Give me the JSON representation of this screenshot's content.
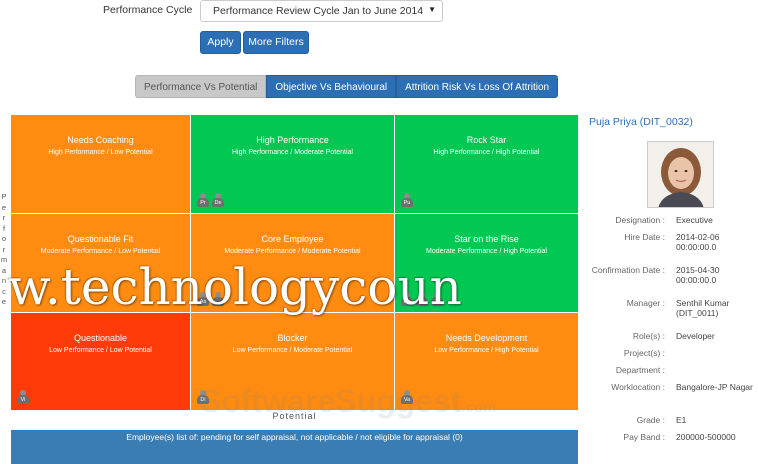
{
  "filters": {
    "performance_cycle_label": "Performance Cycle",
    "performance_cycle_value": "Performance Review Cycle Jan to June 2014",
    "apply_label": "Apply",
    "more_filters_label": "More Filters"
  },
  "tabs": [
    {
      "label": "Performance Vs Potential",
      "active": true
    },
    {
      "label": "Objective Vs Behavioural",
      "active": false
    },
    {
      "label": "Attrition Risk Vs Loss Of Attrition",
      "active": false
    }
  ],
  "grid": {
    "y_axis_label": "Performance",
    "x_axis_label": "Potential",
    "cells": [
      {
        "title": "Needs Coaching",
        "subtitle": "High Performance / Low Potential",
        "color": "#ff8c11",
        "avatars": []
      },
      {
        "title": "High Performance",
        "subtitle": "High Performance / Moderate Potential",
        "color": "#00c853",
        "avatars": [
          "Pr",
          "De"
        ]
      },
      {
        "title": "Rock Star",
        "subtitle": "High Performance / High Potential",
        "color": "#00c853",
        "avatars": [
          "Pu"
        ]
      },
      {
        "title": "Questionable Fit",
        "subtitle": "Moderate Performance / Low Potential",
        "color": "#ff8c11",
        "avatars": []
      },
      {
        "title": "Core Employee",
        "subtitle": "Moderate Performance / Moderate Potential",
        "color": "#ff8c11",
        "avatars": [
          "As",
          ""
        ]
      },
      {
        "title": "Star on the Rise",
        "subtitle": "Moderate Performance / High Potential",
        "color": "#00c853",
        "avatars": [
          "Ra",
          "Ni",
          ""
        ]
      },
      {
        "title": "Questionable",
        "subtitle": "Low Performance / Low Potential",
        "color": "#ff3b0a",
        "avatars": [
          "Vi"
        ]
      },
      {
        "title": "Blocker",
        "subtitle": "Low Performance / Moderate Potential",
        "color": "#ff8c11",
        "avatars": [
          "Di"
        ]
      },
      {
        "title": "Needs Development",
        "subtitle": "Low Performance / High Potential",
        "color": "#ff8c11",
        "avatars": [
          "Va"
        ]
      }
    ]
  },
  "footer": {
    "pending_text": "Employee(s) list of: pending for self appraisal, not applicable / not eligible for appraisal",
    "pending_count": "(0)"
  },
  "profile": {
    "name": "Puja Priya (DIT_0032)",
    "fields": [
      {
        "label": "Designation :",
        "value": "Executive"
      },
      {
        "label": "Hire Date :",
        "value": "2014-02-06 00:00:00.0"
      },
      {
        "label": "Confirmation Date :",
        "value": "2015-04-30 00:00:00.0"
      },
      {
        "label": "Manager :",
        "value": "Senthil Kumar (DIT_0011)"
      },
      {
        "label": "Role(s) :",
        "value": "Developer"
      },
      {
        "label": "Project(s) :",
        "value": ""
      },
      {
        "label": "Department :",
        "value": ""
      },
      {
        "label": "Worklocation :",
        "value": "Bangalore-JP Nagar"
      },
      {
        "label": "Grade :",
        "value": "E1"
      },
      {
        "label": "Pay Band :",
        "value": "200000-500000"
      }
    ]
  },
  "watermarks": {
    "main": "w.technologycoun",
    "secondary": "SoftwareSuggest",
    "secondary_suffix": ".com"
  }
}
